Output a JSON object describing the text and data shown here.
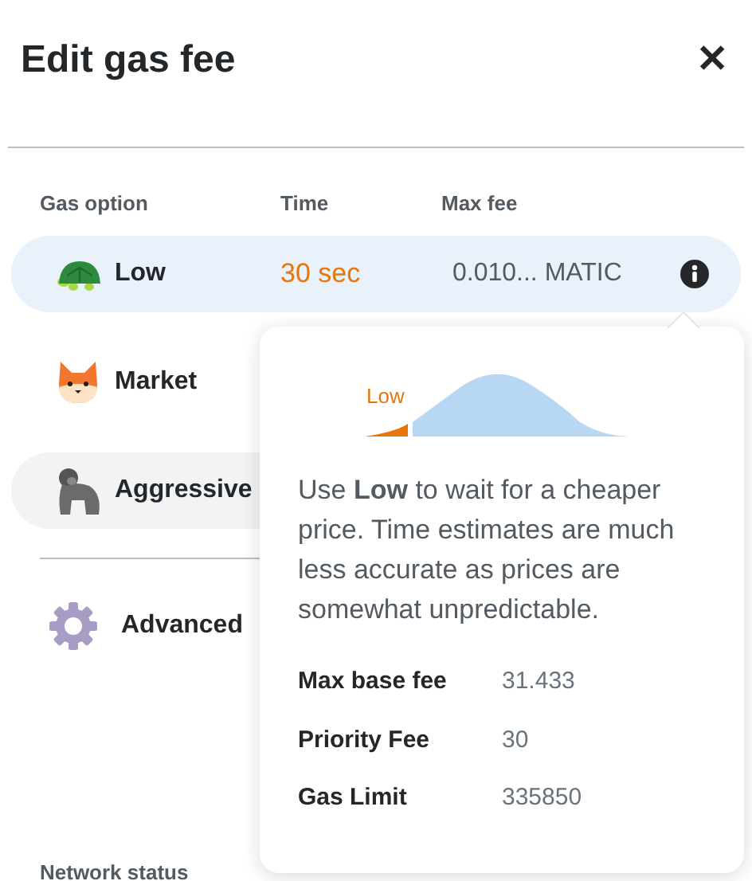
{
  "header": {
    "title": "Edit gas fee",
    "close": "✕"
  },
  "columns": [
    "Gas option",
    "Time",
    "Max fee"
  ],
  "options": [
    {
      "kind": "turtle",
      "label": "Low",
      "time": "30 sec",
      "max_fee": "0.010... MATIC",
      "selected": true,
      "hovered": false
    },
    {
      "kind": "fox",
      "label": "Market",
      "selected": false,
      "hovered": false
    },
    {
      "kind": "gorilla",
      "label": "Aggressive",
      "selected": false,
      "hovered": true
    }
  ],
  "advanced": {
    "label": "Advanced"
  },
  "tooltip": {
    "chart_label": "Low",
    "text": "Use **Low** to wait for a cheaper price. Time estimates are much less accurate as prices are somewhat unpredictable.",
    "details": [
      {
        "label": "Max base fee",
        "value": "31.433"
      },
      {
        "label": "Priority Fee",
        "value": "30"
      },
      {
        "label": "Gas Limit",
        "value": "335850"
      }
    ]
  },
  "network_status": {
    "label": "Network status"
  }
}
